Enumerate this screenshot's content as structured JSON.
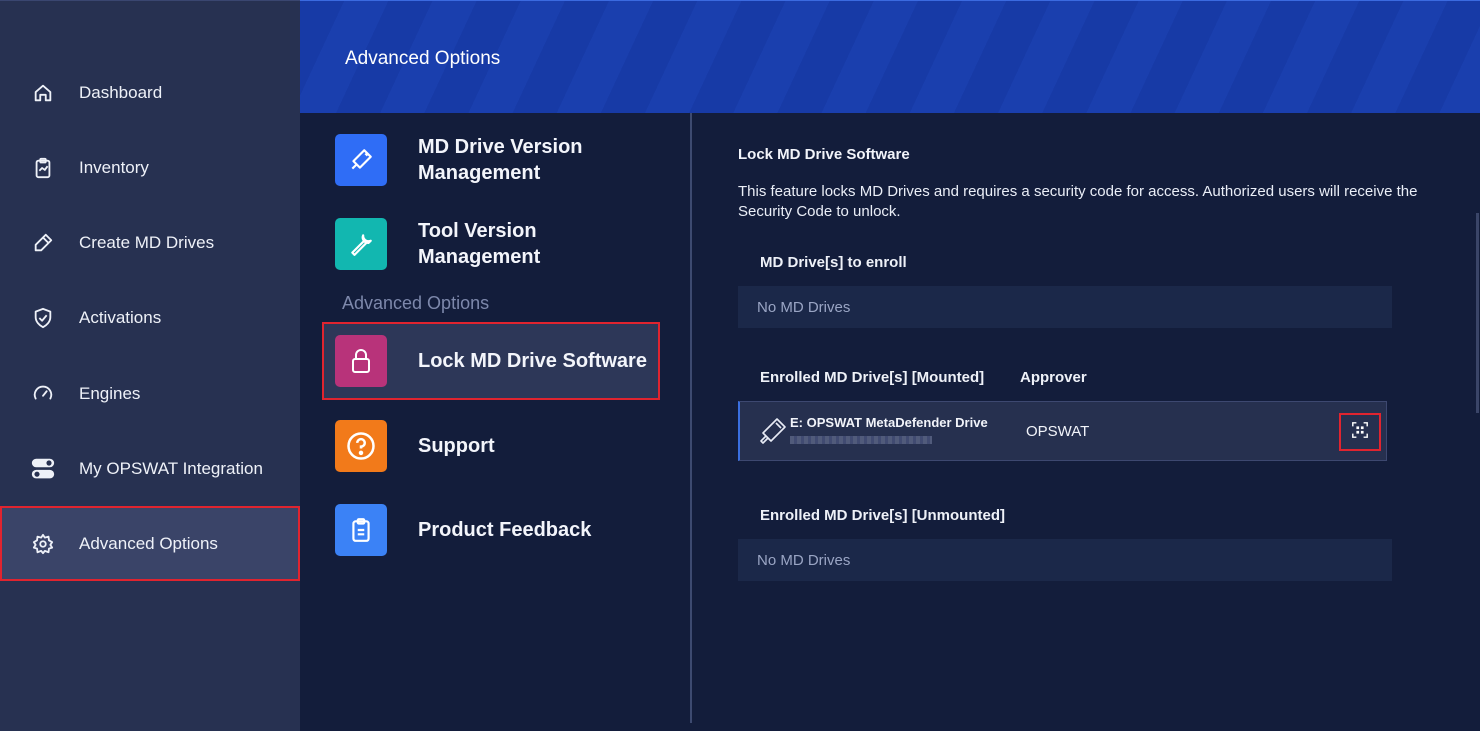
{
  "sidebar": {
    "items": [
      {
        "label": "Dashboard",
        "icon": "home-icon"
      },
      {
        "label": "Inventory",
        "icon": "clipboard-icon"
      },
      {
        "label": "Create MD Drives",
        "icon": "usb-pen-icon"
      },
      {
        "label": "Activations",
        "icon": "shield-check-icon"
      },
      {
        "label": "Engines",
        "icon": "gauge-icon"
      },
      {
        "label": "My OPSWAT Integration",
        "icon": "toggle-icon"
      },
      {
        "label": "Advanced Options",
        "icon": "gear-icon",
        "active": true
      }
    ]
  },
  "header": {
    "title": "Advanced Options"
  },
  "menu": {
    "items": [
      {
        "label": "MD Drive Version Management",
        "icon": "usb-drive-icon",
        "color": "#2f6df6"
      },
      {
        "label": "Tool Version Management",
        "icon": "wrench-icon",
        "color": "#12b7b0"
      }
    ],
    "section_label": "Advanced Options",
    "section_items": [
      {
        "label": "Lock MD Drive Software",
        "icon": "lock-icon",
        "color": "#b8337a",
        "active": true
      },
      {
        "label": "Support",
        "icon": "question-icon",
        "color": "#f27a1a"
      },
      {
        "label": "Product Feedback",
        "icon": "clipboard-list-icon",
        "color": "#3b82f6"
      }
    ]
  },
  "content": {
    "title": "Lock MD Drive Software",
    "description": "This feature locks MD Drives and requires a security code for access. Authorized users will receive the Security Code to unlock.",
    "to_enroll": {
      "heading": "MD Drive[s] to enroll",
      "empty_text": "No MD Drives"
    },
    "mounted": {
      "heading": "Enrolled MD Drive[s] [Mounted]",
      "approver_heading": "Approver",
      "rows": [
        {
          "name": "E: OPSWAT MetaDefender Drive",
          "approver": "OPSWAT",
          "action_icon": "scan-qr-icon"
        }
      ]
    },
    "unmounted": {
      "heading": "Enrolled MD Drive[s] [Unmounted]",
      "empty_text": "No MD Drives"
    }
  },
  "colors": {
    "accent_red": "#e0242f",
    "sidebar_bg": "#273151",
    "content_bg": "#131d3b",
    "header_blue": "#173aa6"
  }
}
